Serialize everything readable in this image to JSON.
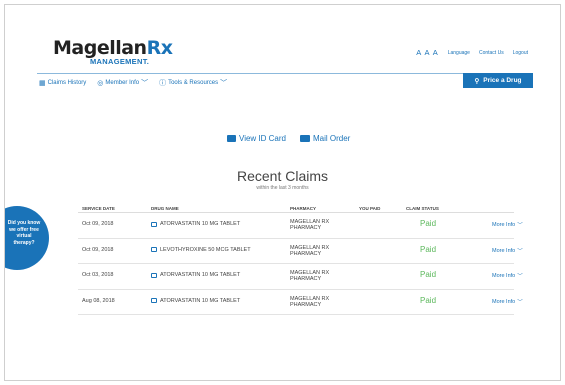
{
  "logo": {
    "brand_main": "Magellan",
    "brand_rx": "Rx",
    "brand_sub": "MANAGEMENT."
  },
  "toplinks": {
    "text_size": "A A A",
    "language": "Language",
    "contact": "Contact Us",
    "logout": "Logout"
  },
  "nav": {
    "items": [
      {
        "label": "Claims History",
        "icon": "calendar-icon"
      },
      {
        "label": "Member Info",
        "icon": "user-icon"
      },
      {
        "label": "Tools & Resources",
        "icon": "help-icon"
      }
    ],
    "price_label": "Price a Drug"
  },
  "actions": {
    "id_card": "View ID Card",
    "mail_order": "Mail Order"
  },
  "claims": {
    "title": "Recent Claims",
    "subtitle": "within the last 3 months",
    "headers": [
      "SERVICE DATE",
      "DRUG NAME",
      "PHARMACY",
      "YOU PAID",
      "CLAIM STATUS"
    ],
    "rows": [
      {
        "date": "Oct 09, 2018",
        "drug": "ATORVASTATIN 10 MG TABLET",
        "pharmacy_1": "MAGELLAN RX",
        "pharmacy_2": "PHARMACY",
        "status": "Paid",
        "more": "More Info"
      },
      {
        "date": "Oct 09, 2018",
        "drug": "LEVOTHYROXINE 50 MCG TABLET",
        "pharmacy_1": "MAGELLAN RX",
        "pharmacy_2": "PHARMACY",
        "status": "Paid",
        "more": "More Info"
      },
      {
        "date": "Oct 03, 2018",
        "drug": "ATORVASTATIN 10 MG TABLET",
        "pharmacy_1": "MAGELLAN RX",
        "pharmacy_2": "PHARMACY",
        "status": "Paid",
        "more": "More Info"
      },
      {
        "date": "Aug 08, 2018",
        "drug": "ATORVASTATIN 10 MG TABLET",
        "pharmacy_1": "MAGELLAN RX",
        "pharmacy_2": "PHARMACY",
        "status": "Paid",
        "more": "More Info"
      }
    ]
  },
  "promo": {
    "line1": "Did you know",
    "line2": "we offer free",
    "line3": "virtual",
    "line4": "therapy?"
  },
  "colors": {
    "brand_blue": "#1a73b8",
    "paid_green": "#5cb85c"
  }
}
